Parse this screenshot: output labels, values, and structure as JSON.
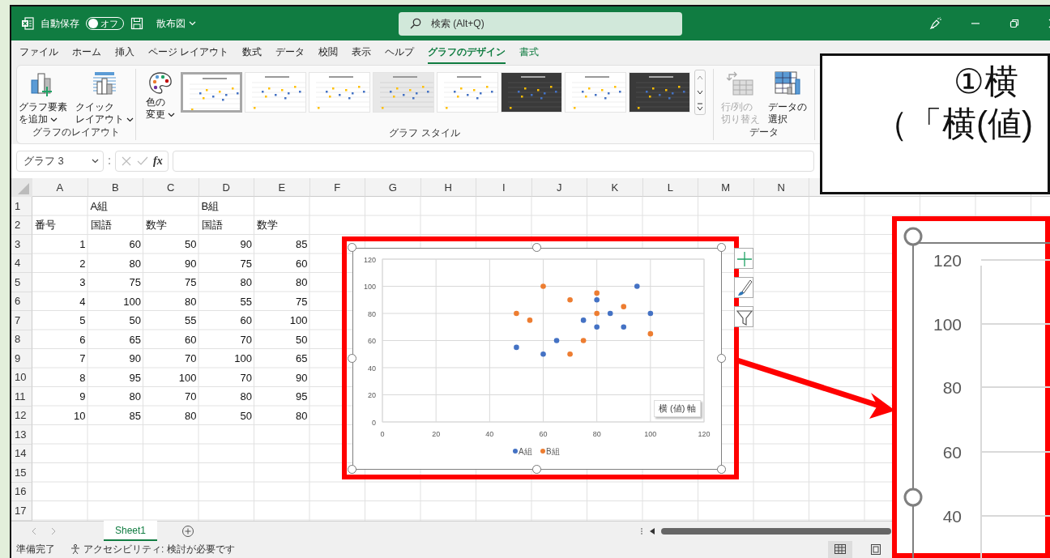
{
  "title_bar": {
    "autosave_label": "自動保存",
    "autosave_toggle": {
      "label": "オフ",
      "on": false
    },
    "file_name": "散布図",
    "search": {
      "placeholder": "検索 (Alt+Q)"
    }
  },
  "ribbon_tabs": [
    {
      "label": "ファイル",
      "kind": "normal",
      "selected": false
    },
    {
      "label": "ホーム",
      "kind": "normal",
      "selected": false
    },
    {
      "label": "挿入",
      "kind": "normal",
      "selected": false
    },
    {
      "label": "ページ レイアウト",
      "kind": "normal",
      "selected": false
    },
    {
      "label": "数式",
      "kind": "normal",
      "selected": false
    },
    {
      "label": "データ",
      "kind": "normal",
      "selected": false
    },
    {
      "label": "校閲",
      "kind": "normal",
      "selected": false
    },
    {
      "label": "表示",
      "kind": "normal",
      "selected": false
    },
    {
      "label": "ヘルプ",
      "kind": "normal",
      "selected": false
    },
    {
      "label": "グラフのデザイン",
      "kind": "contextual",
      "selected": true
    },
    {
      "label": "書式",
      "kind": "contextual",
      "selected": false
    }
  ],
  "ribbon": {
    "layout_group": {
      "label": "グラフのレイアウト",
      "buttons": [
        {
          "kind": "add-element",
          "lines": [
            "グラフ要素",
            "を追加"
          ],
          "dropdown": true
        },
        {
          "kind": "quick-layout",
          "lines": [
            "クイック",
            "レイアウト"
          ],
          "dropdown": true
        }
      ]
    },
    "color_button": {
      "lines": [
        "色の",
        "変更"
      ],
      "dropdown": true
    },
    "style_gallery": {
      "label": "グラフ スタイル",
      "styles": [
        {
          "kind": "light",
          "selected": true
        },
        {
          "kind": "light",
          "selected": false
        },
        {
          "kind": "light",
          "selected": false
        },
        {
          "kind": "gray",
          "selected": false
        },
        {
          "kind": "light",
          "selected": false
        },
        {
          "kind": "dark",
          "selected": false
        },
        {
          "kind": "light",
          "selected": false
        },
        {
          "kind": "dark",
          "selected": false
        }
      ]
    },
    "data_group": {
      "label": "データ",
      "buttons": [
        {
          "kind": "switch",
          "lines": [
            "行/列の",
            "切り替え"
          ],
          "disabled": true
        },
        {
          "kind": "select",
          "lines": [
            "データの",
            "選択"
          ],
          "disabled": false
        }
      ]
    }
  },
  "formula_bar": {
    "name_box": "グラフ 3",
    "function_label": "fx"
  },
  "sheet": {
    "columns": [
      "A",
      "B",
      "C",
      "D",
      "E",
      "F",
      "G",
      "H",
      "I",
      "J",
      "K",
      "L",
      "M",
      "N"
    ],
    "rows": [
      {
        "number": "1",
        "kind": "text",
        "cells": [
          null,
          "A組",
          null,
          "B組",
          null
        ]
      },
      {
        "number": "2",
        "kind": "text",
        "cells": [
          "番号",
          "国語",
          "数学",
          "国語",
          "数学"
        ]
      },
      {
        "number": "3",
        "kind": "numbers",
        "cells": [
          "1",
          "60",
          "50",
          "90",
          "85"
        ]
      },
      {
        "number": "4",
        "kind": "numbers",
        "cells": [
          "2",
          "80",
          "90",
          "75",
          "60"
        ]
      },
      {
        "number": "5",
        "kind": "numbers",
        "cells": [
          "3",
          "75",
          "75",
          "80",
          "80"
        ]
      },
      {
        "number": "6",
        "kind": "numbers",
        "cells": [
          "4",
          "100",
          "80",
          "55",
          "75"
        ]
      },
      {
        "number": "7",
        "kind": "numbers",
        "cells": [
          "5",
          "50",
          "55",
          "60",
          "100"
        ]
      },
      {
        "number": "8",
        "kind": "numbers",
        "cells": [
          "6",
          "65",
          "60",
          "70",
          "50"
        ]
      },
      {
        "number": "9",
        "kind": "numbers",
        "cells": [
          "7",
          "90",
          "70",
          "100",
          "65"
        ]
      },
      {
        "number": "10",
        "kind": "numbers",
        "cells": [
          "8",
          "95",
          "100",
          "70",
          "90"
        ]
      },
      {
        "number": "11",
        "kind": "numbers",
        "cells": [
          "9",
          "80",
          "70",
          "80",
          "95"
        ]
      },
      {
        "number": "12",
        "kind": "numbers",
        "cells": [
          "10",
          "85",
          "80",
          "50",
          "80"
        ]
      },
      {
        "number": "13"
      },
      {
        "number": "14"
      },
      {
        "number": "15"
      },
      {
        "number": "16"
      },
      {
        "number": "17"
      }
    ]
  },
  "chart": {
    "tooltip": "横 (値) 軸",
    "chart_data": {
      "type": "scatter",
      "grid": true,
      "legend": true,
      "xlim": [
        0,
        120
      ],
      "ylim": [
        0,
        120
      ],
      "xticks": [
        {
          "value": 0,
          "label": "0"
        },
        {
          "value": 20,
          "label": "20"
        },
        {
          "value": 40,
          "label": "40"
        },
        {
          "value": 60,
          "label": "60"
        },
        {
          "value": 80,
          "label": "80"
        },
        {
          "value": 100,
          "label": "100"
        },
        {
          "value": 120,
          "label": "120"
        }
      ],
      "yticks": [
        {
          "value": 0,
          "label": "0"
        },
        {
          "value": 20,
          "label": "20"
        },
        {
          "value": 40,
          "label": "40"
        },
        {
          "value": 60,
          "label": "60"
        },
        {
          "value": 80,
          "label": "80"
        },
        {
          "value": 100,
          "label": "100"
        },
        {
          "value": 120,
          "label": "120"
        }
      ],
      "series": [
        {
          "name": "A組",
          "color": "#4472c4",
          "x": [
            60,
            80,
            75,
            100,
            50,
            65,
            90,
            95,
            80,
            85
          ],
          "values": [
            50,
            90,
            75,
            80,
            55,
            60,
            70,
            100,
            70,
            80
          ]
        },
        {
          "name": "B組",
          "color": "#ed7d31",
          "x": [
            90,
            75,
            80,
            55,
            60,
            70,
            100,
            70,
            80,
            50
          ],
          "values": [
            85,
            60,
            80,
            75,
            100,
            50,
            65,
            90,
            95,
            80
          ]
        }
      ]
    }
  },
  "sheet_tabs": [
    {
      "label": "Sheet1",
      "selected": true
    }
  ],
  "status_bar": {
    "ready": "準備完了",
    "accessibility": "アクセシビリティ: 検討が必要です"
  },
  "annotation": {
    "lines": [
      "①横",
      "（「横(値)"
    ]
  },
  "zoom_inset": {
    "y_labels": [
      "120",
      "100",
      "80",
      "60",
      "40"
    ]
  }
}
